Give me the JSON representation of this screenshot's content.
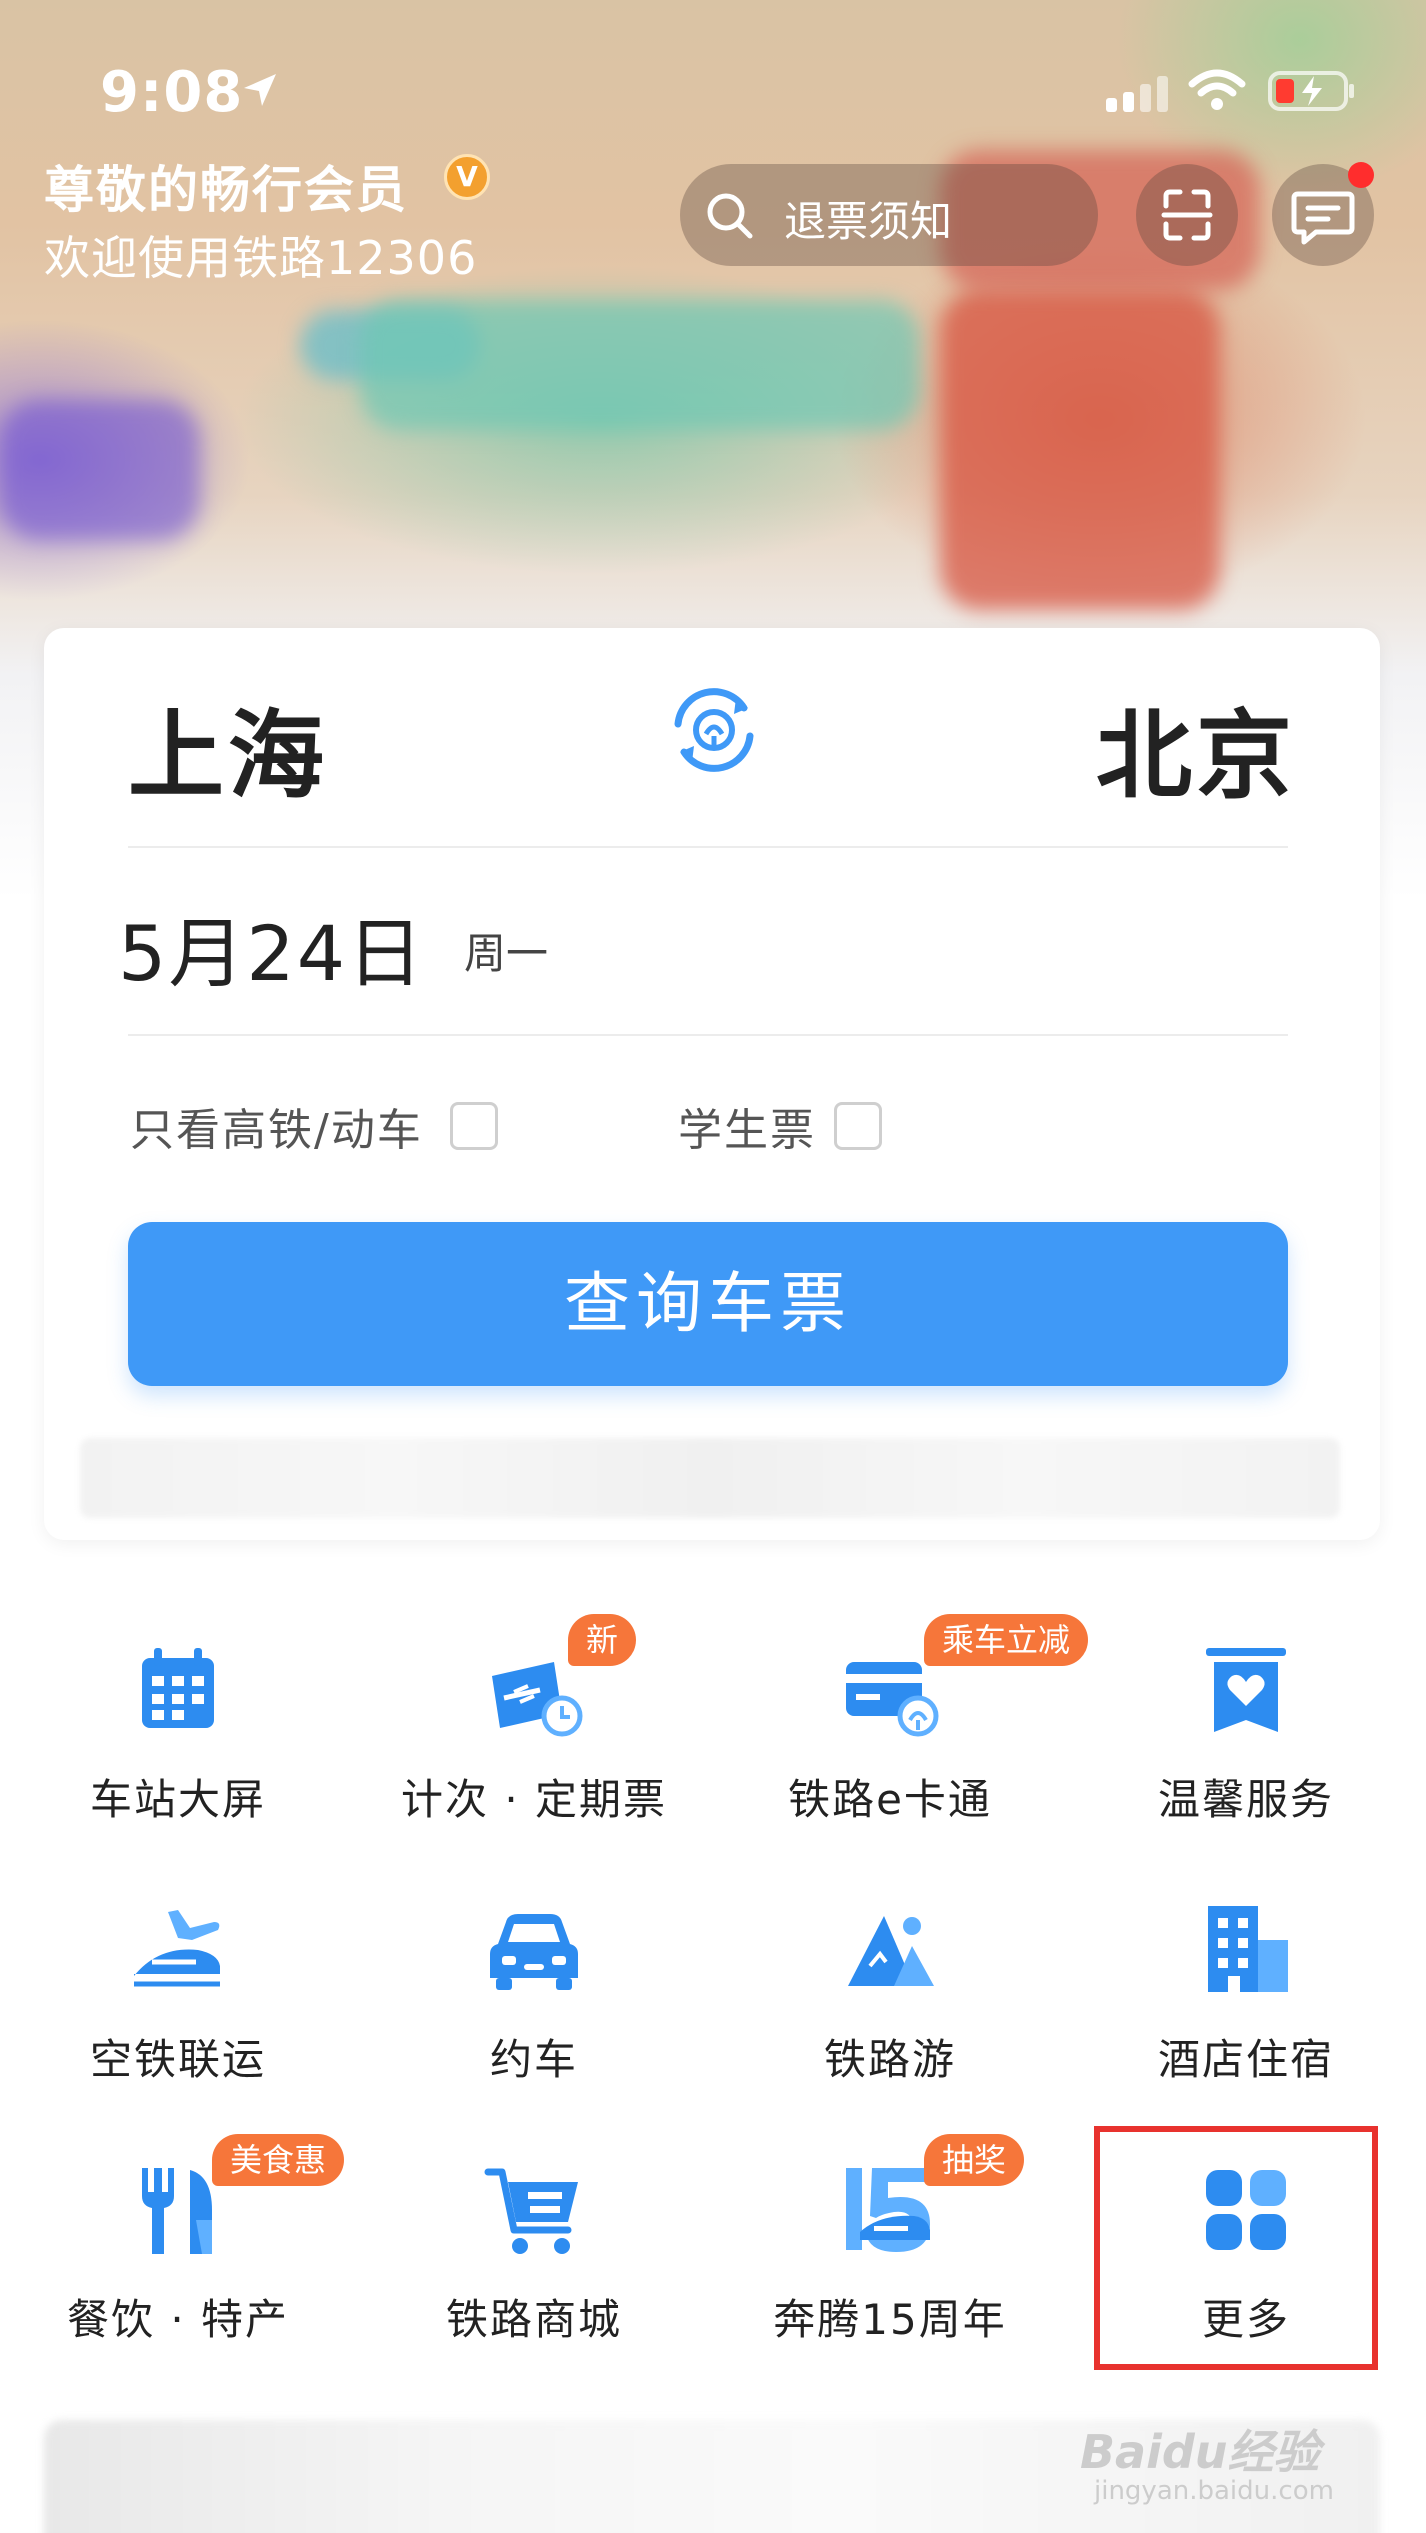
{
  "status_bar": {
    "time": "9:08"
  },
  "header": {
    "greeting_title": "尊敬的畅行会员",
    "vip_badge": "V",
    "greeting_sub": "欢迎使用铁路12306",
    "search_placeholder": "退票须知"
  },
  "ticket_form": {
    "from_city": "上海",
    "to_city": "北京",
    "date": "5月24日",
    "weekday": "周一",
    "option_highspeed": "只看高铁/动车",
    "option_student": "学生票",
    "query_button": "查询车票"
  },
  "services": [
    {
      "label": "车站大屏",
      "icon": "calendar-grid-icon",
      "badge": ""
    },
    {
      "label": "计次 · 定期票",
      "icon": "ticket-clock-icon",
      "badge": "新"
    },
    {
      "label": "铁路e卡通",
      "icon": "railway-card-icon",
      "badge": "乘车立减"
    },
    {
      "label": "温馨服务",
      "icon": "heart-box-icon",
      "badge": ""
    },
    {
      "label": "空铁联运",
      "icon": "plane-train-icon",
      "badge": ""
    },
    {
      "label": "约车",
      "icon": "car-icon",
      "badge": ""
    },
    {
      "label": "铁路游",
      "icon": "mountain-icon",
      "badge": ""
    },
    {
      "label": "酒店住宿",
      "icon": "building-icon",
      "badge": ""
    },
    {
      "label": "餐饮 · 特产",
      "icon": "fork-knife-icon",
      "badge": "美食惠"
    },
    {
      "label": "铁路商城",
      "icon": "shopping-cart-icon",
      "badge": ""
    },
    {
      "label": "奔腾15周年",
      "icon": "anniversary-15-icon",
      "badge": "抽奖"
    },
    {
      "label": "更多",
      "icon": "more-grid-icon",
      "badge": ""
    }
  ],
  "watermark": {
    "brand": "Baidu经验",
    "url": "jingyan.baidu.com"
  },
  "colors": {
    "primary": "#3f99f7",
    "badge": "#f6763a",
    "highlight": "#e8322e"
  }
}
